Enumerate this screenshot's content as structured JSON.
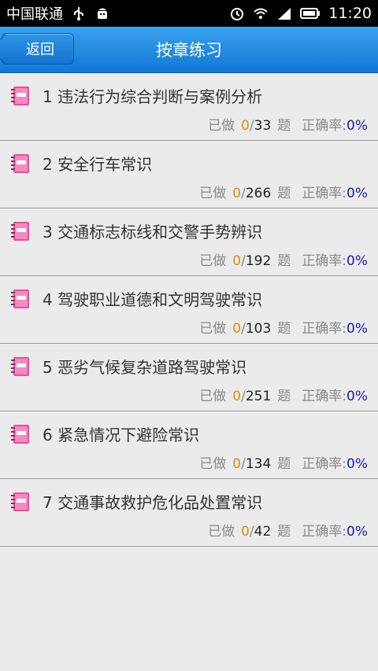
{
  "status_bar": {
    "carrier": "中国联通",
    "time": "11:20"
  },
  "header": {
    "back_label": "返回",
    "title": "按章练习"
  },
  "stats_labels": {
    "done": "已做",
    "question": "题",
    "accuracy": "正确率:"
  },
  "chapters": [
    {
      "title": "1 违法行为综合判断与案例分析",
      "done": "0",
      "total": "33",
      "rate": "0%"
    },
    {
      "title": "2 安全行车常识",
      "done": "0",
      "total": "266",
      "rate": "0%"
    },
    {
      "title": "3 交通标志标线和交警手势辨识",
      "done": "0",
      "total": "192",
      "rate": "0%"
    },
    {
      "title": "4 驾驶职业道德和文明驾驶常识",
      "done": "0",
      "total": "103",
      "rate": "0%"
    },
    {
      "title": "5 恶劣气候复杂道路驾驶常识",
      "done": "0",
      "total": "251",
      "rate": "0%"
    },
    {
      "title": "6 紧急情况下避险常识",
      "done": "0",
      "total": "134",
      "rate": "0%"
    },
    {
      "title": "7 交通事故救护危化品处置常识",
      "done": "0",
      "total": "42",
      "rate": "0%"
    }
  ]
}
